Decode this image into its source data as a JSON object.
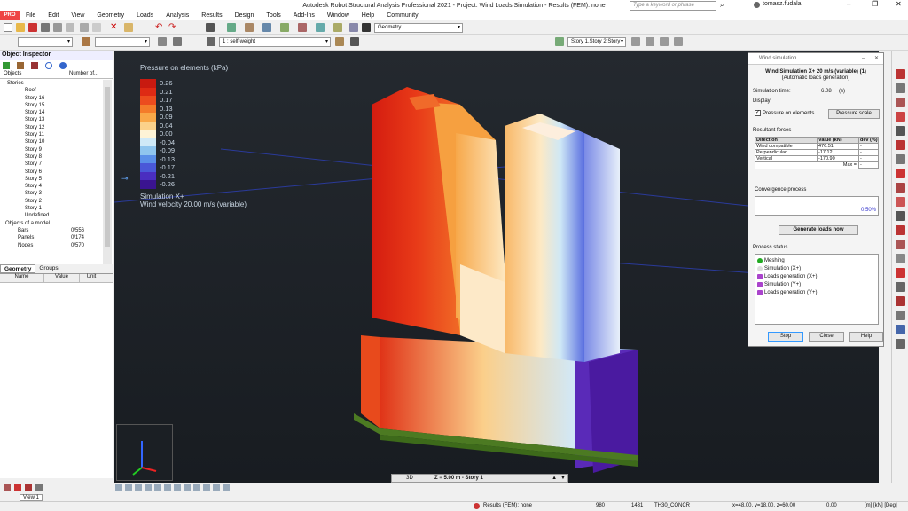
{
  "app": {
    "title": "Autodesk Robot Structural Analysis Professional 2021 - Project: Wind Loads Simulation - Results (FEM): none",
    "logo_text": "PRO",
    "search_placeholder": "Type a keyword or phrase",
    "user": "tomasz.fudala"
  },
  "menu": [
    "File",
    "Edit",
    "View",
    "Geometry",
    "Loads",
    "Analysis",
    "Results",
    "Design",
    "Tools",
    "Add-Ins",
    "Window",
    "Help",
    "Community"
  ],
  "toolbar": {
    "geometry_select": "Geometry",
    "load_case_select": "1 : self-weight",
    "story_select": "Story 1,Story 2,Story"
  },
  "object_inspector": {
    "title": "Object Inspector",
    "col_objects": "Objects",
    "col_number": "Number of...",
    "stories_label": "Stories",
    "stories": [
      "Roof",
      "Story 16",
      "Story 15",
      "Story 14",
      "Story 13",
      "Story 12",
      "Story 11",
      "Story 10",
      "Story 9",
      "Story 8",
      "Story 7",
      "Story 6",
      "Story 5",
      "Story 4",
      "Story 3",
      "Story 2",
      "Story 1",
      "Undefined"
    ],
    "model_objects_label": "Objects of a model",
    "model_objects": [
      {
        "name": "Bars",
        "count": "0/556"
      },
      {
        "name": "Panels",
        "count": "0/174"
      },
      {
        "name": "Nodes",
        "count": "0/570"
      }
    ],
    "tabs": [
      "Geometry",
      "Groups"
    ]
  },
  "props_grid": {
    "col_name": "Name",
    "col_value": "Value",
    "col_unit": "Unit"
  },
  "legend": {
    "title": "Pressure on elements (kPa)",
    "levels": [
      {
        "value": "0.26",
        "color": "#c81a10"
      },
      {
        "value": "0.21",
        "color": "#de2a14"
      },
      {
        "value": "0.17",
        "color": "#ec4c1e"
      },
      {
        "value": "0.13",
        "color": "#f47c2a"
      },
      {
        "value": "0.09",
        "color": "#f9a848"
      },
      {
        "value": "0.04",
        "color": "#fbd18a"
      },
      {
        "value": "0.00",
        "color": "#fdf3d6"
      },
      {
        "value": "-0.04",
        "color": "#cfe9f7"
      },
      {
        "value": "-0.09",
        "color": "#8fc5ee"
      },
      {
        "value": "-0.13",
        "color": "#5a8fe8"
      },
      {
        "value": "-0.17",
        "color": "#4a58d8"
      },
      {
        "value": "-0.21",
        "color": "#4a2ec0"
      },
      {
        "value": "-0.26",
        "color": "#3a1490"
      }
    ],
    "simulation_label": "Simulation X+",
    "velocity_label": "Wind velocity 20.00 m/s  (variable)"
  },
  "view_bar": {
    "mode": "3D",
    "level": "Z = 5.00 m - Story 1"
  },
  "wind_dialog": {
    "caption": "Wind simulation",
    "heading": "Wind Simulation X+ 20 m/s (variable) (1)",
    "subheading": "(Automatic loads generation)",
    "sim_time_label": "Simulation time:",
    "sim_time_value": "6.08",
    "sim_time_unit": "(s)",
    "display_label": "Display",
    "pressure_checkbox": "Pressure on elements",
    "pressure_scale_btn": "Pressure scale",
    "resultant_label": "Resultant forces",
    "table_headers": [
      "Direction",
      "Value (kN)",
      "dev (%)"
    ],
    "table_rows": [
      [
        "Wind compatible",
        "476.51",
        "-"
      ],
      [
        "Perpendicular",
        "-17.12",
        "-"
      ],
      [
        "Vertical",
        "-170.90",
        "-"
      ]
    ],
    "max_label": "Max =",
    "max_value": "-",
    "convergence_label": "Convergence process",
    "convergence_value": "0.50%",
    "generate_btn": "Generate loads now",
    "status_label": "Process status",
    "status_items": [
      "Meshing",
      "Simulation (X+)",
      "Loads generation (X+)",
      "Simulation (Y+)",
      "Loads generation (Y+)"
    ],
    "stop_btn": "Stop",
    "close_btn": "Close",
    "help_btn": "Help"
  },
  "bottom": {
    "view_tab": "View 1"
  },
  "statusbar": {
    "results": "Results (FEM): none",
    "n1": "980",
    "n2": "1431",
    "section": "TH30_CONCR",
    "coords": "x=48.00, y=18.00, z=60.00",
    "zero": "0.00",
    "units": "[m] [kN] [Deg]"
  }
}
